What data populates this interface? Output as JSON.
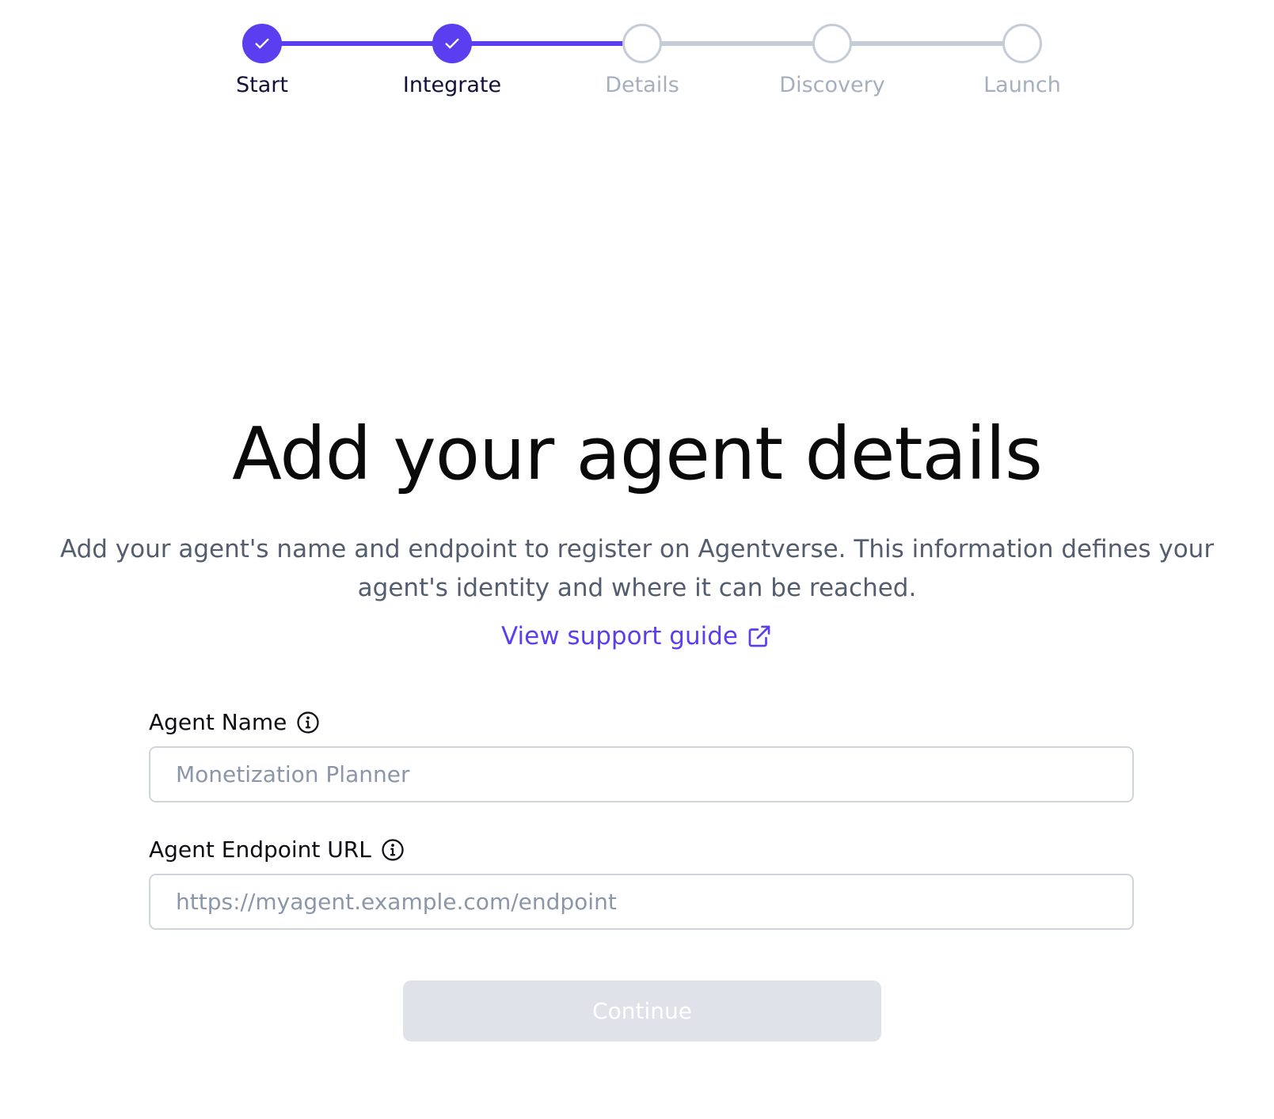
{
  "stepper": {
    "steps": [
      {
        "label": "Start",
        "status": "complete"
      },
      {
        "label": "Integrate",
        "status": "complete"
      },
      {
        "label": "Details",
        "status": "upcoming"
      },
      {
        "label": "Discovery",
        "status": "upcoming"
      },
      {
        "label": "Launch",
        "status": "upcoming"
      }
    ]
  },
  "main": {
    "title": "Add your agent details",
    "description": "Add your agent's name and endpoint to register on Agentverse. This information defines your agent's identity and where it can be reached.",
    "support_link": {
      "label": "View support guide",
      "icon": "external-link-icon"
    }
  },
  "form": {
    "agent_name": {
      "label": "Agent Name",
      "icon": "info-icon",
      "value": "",
      "placeholder": "Monetization Planner"
    },
    "agent_endpoint": {
      "label": "Agent Endpoint URL",
      "icon": "info-icon",
      "value": "",
      "placeholder": "https://myagent.example.com/endpoint"
    },
    "continue_label": "Continue"
  },
  "colors": {
    "accent": "#5b3ef0",
    "inactive": "#c6ccd6",
    "disabled_button": "#dfe3e9"
  }
}
